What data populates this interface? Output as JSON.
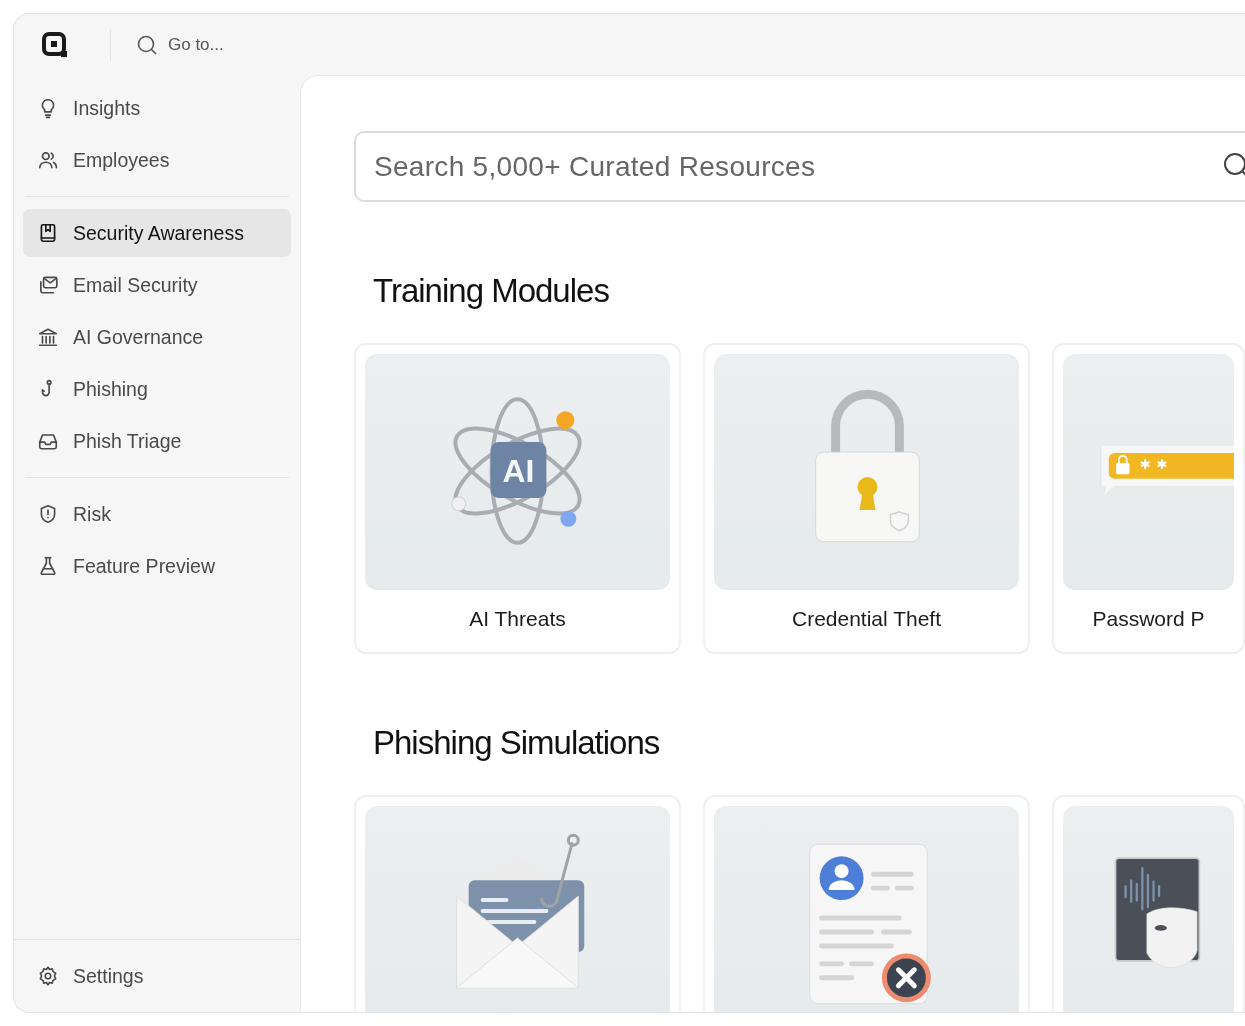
{
  "topbar": {
    "search_placeholder": "Go to..."
  },
  "sidebar": {
    "sections": [
      [
        {
          "label": "Insights",
          "kind": "bulb",
          "selected": false
        },
        {
          "label": "Employees",
          "kind": "people",
          "selected": false
        }
      ],
      [
        {
          "label": "Security Awareness",
          "kind": "book",
          "selected": true
        },
        {
          "label": "Email Security",
          "kind": "mail",
          "selected": false
        },
        {
          "label": "AI Governance",
          "kind": "bank",
          "selected": false
        },
        {
          "label": "Phishing",
          "kind": "hook",
          "selected": false
        },
        {
          "label": "Phish Triage",
          "kind": "inbox",
          "selected": false
        }
      ],
      [
        {
          "label": "Risk",
          "kind": "shield",
          "selected": false
        },
        {
          "label": "Feature Preview",
          "kind": "flask",
          "selected": false
        }
      ]
    ],
    "footer": {
      "label": "Settings",
      "kind": "gear",
      "selected": false
    }
  },
  "main": {
    "search": {
      "placeholder": "Search 5,000+ Curated Resources"
    },
    "sections": [
      {
        "title": "Training Modules",
        "cards": [
          {
            "kind": "atom",
            "art_text": "AI",
            "title": "AI Threats"
          },
          {
            "kind": "padlock",
            "title": "Credential Theft"
          },
          {
            "kind": "password",
            "title": "Password P"
          }
        ]
      },
      {
        "title": "Phishing Simulations",
        "cards": [
          {
            "kind": "envelope"
          },
          {
            "kind": "document"
          },
          {
            "kind": "mask"
          }
        ]
      }
    ]
  }
}
